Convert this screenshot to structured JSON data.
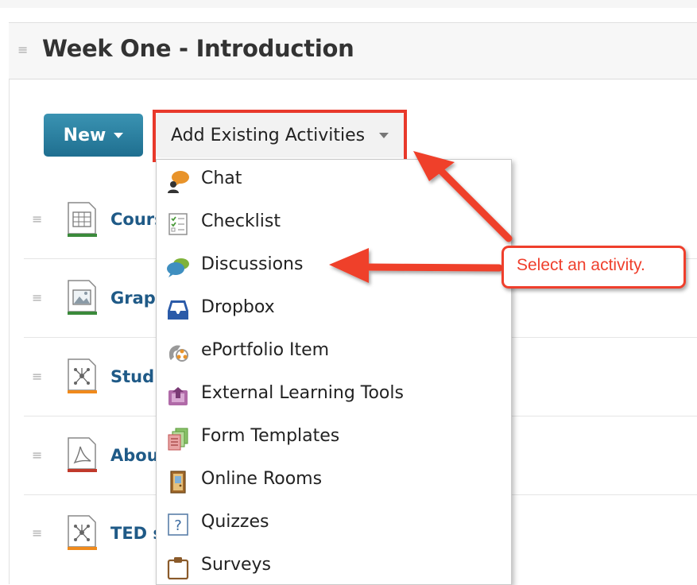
{
  "module": {
    "title": "Week One - Introduction"
  },
  "toolbar": {
    "new_label": "New",
    "add_existing_label": "Add Existing Activities"
  },
  "topics": [
    {
      "title": "Cours",
      "icon": "spreadsheet-doc-icon",
      "accent": "#3a8a3a"
    },
    {
      "title": "Grap",
      "icon": "image-doc-icon",
      "accent": "#3a8a3a"
    },
    {
      "title": "Stud",
      "icon": "network-doc-icon",
      "accent": "#f08a1c"
    },
    {
      "title": "Abou",
      "icon": "pdf-doc-icon",
      "accent": "#c0392b"
    },
    {
      "title": "TED s",
      "icon": "network-doc-icon",
      "accent": "#f08a1c"
    }
  ],
  "menu": {
    "items": [
      {
        "label": "Chat",
        "icon": "chat-icon"
      },
      {
        "label": "Checklist",
        "icon": "checklist-icon"
      },
      {
        "label": "Discussions",
        "icon": "discussions-icon"
      },
      {
        "label": "Dropbox",
        "icon": "dropbox-icon"
      },
      {
        "label": "ePortfolio Item",
        "icon": "eportfolio-icon"
      },
      {
        "label": "External Learning Tools",
        "icon": "external-tools-icon"
      },
      {
        "label": "Form Templates",
        "icon": "form-templates-icon"
      },
      {
        "label": "Online Rooms",
        "icon": "online-rooms-icon"
      },
      {
        "label": "Quizzes",
        "icon": "quizzes-icon"
      },
      {
        "label": "Surveys",
        "icon": "surveys-icon"
      }
    ]
  },
  "annotation": {
    "callout_text": "Select an activity.",
    "color": "#ef3f2c"
  }
}
